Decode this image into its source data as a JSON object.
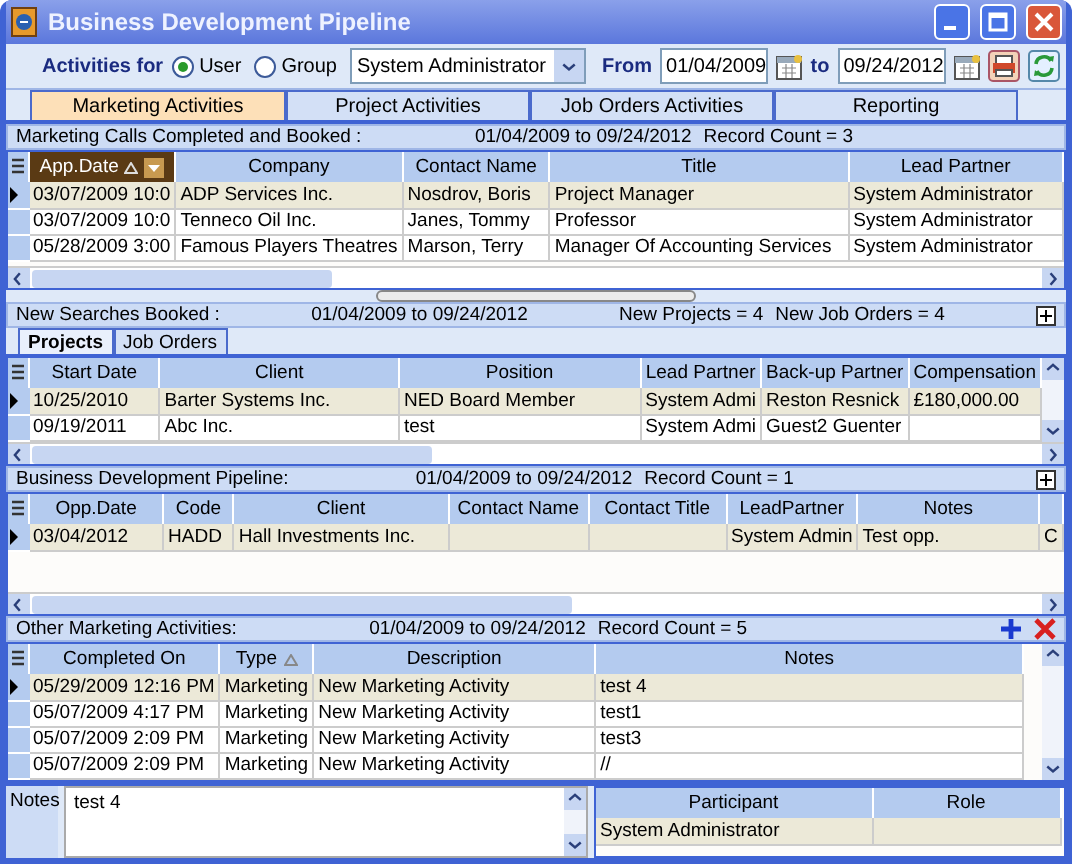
{
  "window": {
    "title": "Business Development Pipeline"
  },
  "toolbar": {
    "label": "Activities for",
    "options": [
      {
        "label": "User",
        "selected": true
      },
      {
        "label": "Group",
        "selected": false
      }
    ],
    "person": "System Administrator",
    "from_label": "From",
    "from": "01/04/2009",
    "to_label": "to",
    "to": "09/24/2012"
  },
  "tabs": [
    {
      "label": "Marketing Activities",
      "selected": true
    },
    {
      "label": "Project Activities",
      "selected": false
    },
    {
      "label": "Job Orders Activities",
      "selected": false
    },
    {
      "label": "Reporting",
      "selected": false
    }
  ],
  "marketing_calls": {
    "title": "Marketing Calls Completed and Booked :",
    "range": "01/04/2009 to 09/24/2012",
    "count": "Record Count = 3",
    "table": {
      "columns": [
        {
          "label": "App.Date",
          "sorted": true,
          "active": true
        },
        {
          "label": "Company",
          "sorted": false,
          "active": false
        },
        {
          "label": "Contact Name",
          "sorted": false,
          "active": false
        },
        {
          "label": "Title",
          "sorted": false,
          "active": false
        },
        {
          "label": "Lead Partner",
          "sorted": false,
          "active": false
        }
      ],
      "rows": [
        {
          "selected": true,
          "cells": [
            "03/07/2009 10:0",
            "ADP Services Inc.",
            "Nosdrov, Boris",
            "Project Manager",
            "System Administrator"
          ]
        },
        {
          "selected": false,
          "cells": [
            "03/07/2009 10:0",
            "Tenneco Oil Inc.",
            "Janes, Tommy",
            "Professor",
            "System Administrator"
          ]
        },
        {
          "selected": false,
          "cells": [
            "05/28/2009 3:00",
            "Famous Players Theatres",
            "Marson, Terry",
            "Manager Of Accounting Services",
            "System Administrator"
          ]
        }
      ]
    }
  },
  "searches": {
    "title": "New Searches Booked :",
    "range": "01/04/2009 to 09/24/2012",
    "projects": "New Projects = 4",
    "job_orders": "New Job Orders = 4",
    "tabs": [
      {
        "label": "Projects",
        "selected": true
      },
      {
        "label": "Job Orders",
        "selected": false
      }
    ],
    "table": {
      "columns": [
        {
          "label": "Start Date"
        },
        {
          "label": "Client"
        },
        {
          "label": "Position"
        },
        {
          "label": "Lead Partner"
        },
        {
          "label": "Back-up Partner"
        },
        {
          "label": "Compensation"
        }
      ],
      "rows": [
        {
          "selected": true,
          "cells": [
            "10/25/2010",
            "Barter Systems Inc.",
            "NED Board Member",
            "System Admi",
            "Reston Resnick",
            "£180,000.00"
          ]
        },
        {
          "selected": false,
          "cells": [
            "09/19/2011",
            "Abc Inc.",
            "test",
            "System Admi",
            "Guest2 Guenter",
            ""
          ]
        }
      ]
    }
  },
  "pipeline": {
    "title": "Business Development Pipeline:",
    "range": "01/04/2009 to 09/24/2012",
    "count": "Record Count = 1",
    "table": {
      "columns": [
        {
          "label": "Opp.Date"
        },
        {
          "label": "Code"
        },
        {
          "label": "Client"
        },
        {
          "label": "Contact Name"
        },
        {
          "label": "Contact Title"
        },
        {
          "label": "LeadPartner"
        },
        {
          "label": "Notes"
        },
        {}
      ],
      "rows": [
        {
          "selected": true,
          "cells": [
            "03/04/2012",
            "HADD",
            "Hall Investments Inc.",
            "",
            "",
            "System Admin",
            "Test opp.",
            "C"
          ]
        }
      ]
    }
  },
  "other": {
    "title": "Other Marketing Activities:",
    "range": "01/04/2009 to 09/24/2012",
    "count": "Record Count = 5",
    "table": {
      "columns": [
        {
          "label": "Completed On",
          "sorted": false
        },
        {
          "label": "Type",
          "sorted": true
        },
        {
          "label": "Description",
          "sorted": false
        },
        {
          "label": "Notes",
          "sorted": false
        }
      ],
      "rows": [
        {
          "selected": true,
          "cells": [
            "05/29/2009 12:16 PM",
            "Marketing",
            "New Marketing Activity",
            "test 4"
          ]
        },
        {
          "selected": false,
          "cells": [
            "05/07/2009 4:17 PM",
            "Marketing",
            "New Marketing Activity",
            "test1"
          ]
        },
        {
          "selected": false,
          "cells": [
            "05/07/2009 2:09 PM",
            "Marketing",
            "New Marketing Activity",
            "test3"
          ]
        },
        {
          "selected": false,
          "cells": [
            "05/07/2009 2:09 PM",
            "Marketing",
            "New Marketing Activity",
            "//"
          ]
        }
      ]
    },
    "notes": {
      "label": "Notes",
      "value": "test 4"
    },
    "participants": {
      "columns": [
        {
          "label": "Participant"
        },
        {
          "label": "Role"
        }
      ],
      "rows": [
        {
          "selected": true,
          "cells": [
            "System Administrator",
            ""
          ]
        }
      ]
    }
  }
}
